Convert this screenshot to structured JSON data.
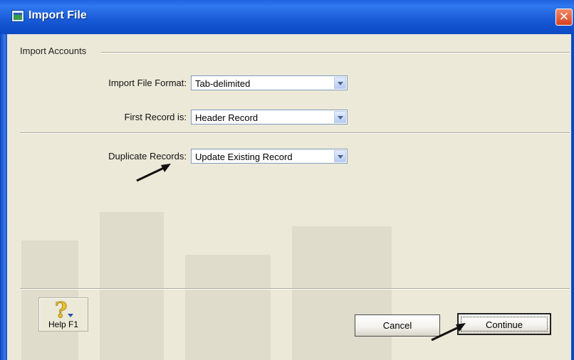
{
  "window": {
    "title": "Import File",
    "close_glyph": "✕"
  },
  "group": {
    "label": "Import Accounts"
  },
  "fields": {
    "import_format": {
      "label": "Import File Format:",
      "value": "Tab-delimited"
    },
    "first_record": {
      "label": "First Record is:",
      "value": "Header Record"
    },
    "duplicate_records": {
      "label": "Duplicate Records:",
      "value": "Update Existing Record"
    }
  },
  "buttons": {
    "help_label": "Help F1",
    "help_glyph": "?",
    "cancel_label": "Cancel",
    "continue_label": "Continue"
  },
  "icons": [
    "window-app-icon",
    "close-icon",
    "dropdown-arrow-icon",
    "help-question-icon"
  ],
  "colors": {
    "titlebar": "#1f62e0",
    "face": "#ece9d8",
    "close": "#d6411e",
    "input_border": "#7f9db9"
  }
}
